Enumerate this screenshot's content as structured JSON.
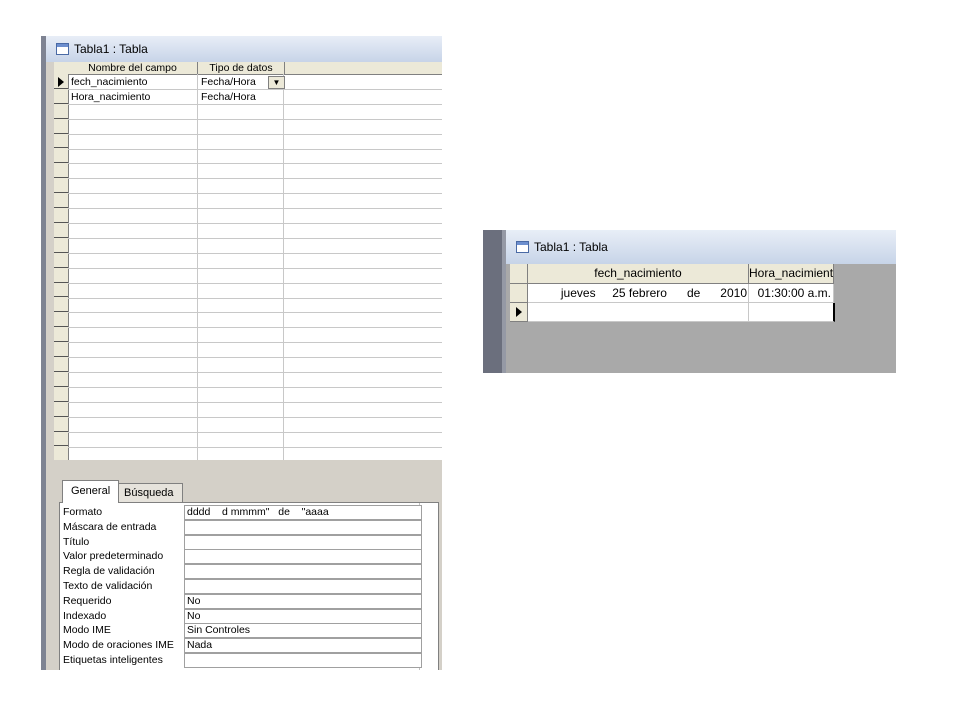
{
  "design_window": {
    "title": "Tabla1 : Tabla",
    "columns": [
      "Nombre del campo",
      "Tipo de datos"
    ],
    "fields": [
      {
        "name": "fech_nacimiento",
        "type": "Fecha/Hora"
      },
      {
        "name": "Hora_nacimiento",
        "type": "Fecha/Hora"
      }
    ],
    "tabs": [
      "General",
      "Búsqueda"
    ],
    "properties": [
      {
        "label": "Formato",
        "value": "dddd    d mmmm\"   de    \"aaaa"
      },
      {
        "label": "Máscara de entrada",
        "value": ""
      },
      {
        "label": "Título",
        "value": ""
      },
      {
        "label": "Valor predeterminado",
        "value": ""
      },
      {
        "label": "Regla de validación",
        "value": ""
      },
      {
        "label": "Texto de validación",
        "value": ""
      },
      {
        "label": "Requerido",
        "value": "No"
      },
      {
        "label": "Indexado",
        "value": "No"
      },
      {
        "label": "Modo IME",
        "value": "Sin Controles"
      },
      {
        "label": "Modo de oraciones IME",
        "value": "Nada"
      },
      {
        "label": "Etiquetas inteligentes",
        "value": ""
      }
    ]
  },
  "sheet_window": {
    "title": "Tabla1 : Tabla",
    "columns": [
      "fech_nacimiento",
      "Hora_nacimient"
    ],
    "rows": [
      {
        "fech_nacimiento": "jueves     25 febrero      de      2010",
        "hora_nacimiento": "01:30:00 a.m."
      }
    ]
  }
}
